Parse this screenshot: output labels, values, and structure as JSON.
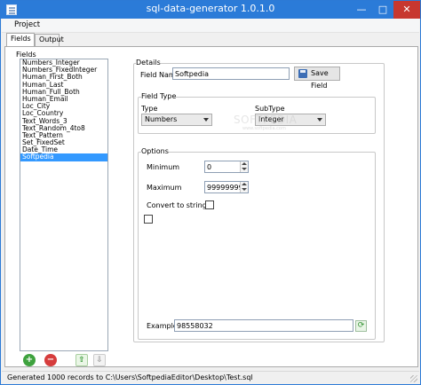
{
  "window": {
    "title": "sql-data-generator 1.0.1.0"
  },
  "titlebar_buttons": {
    "minimize": "—",
    "maximize": "□",
    "close": "✕"
  },
  "menu": {
    "items": [
      "Project"
    ]
  },
  "tabs": [
    {
      "label": "Fields",
      "active": true
    },
    {
      "label": "Output",
      "active": false
    }
  ],
  "fields_panel": {
    "label": "Fields",
    "items": [
      "Numbers_Integer",
      "Numbers_FixedInteger",
      "Human_First_Both",
      "Human_Last",
      "Human_Full_Both",
      "Human_Email",
      "Loc_City",
      "Loc_Country",
      "Text_Words_3",
      "Text_Random_4to8",
      "Text_Pattern",
      "Set_FixedSet",
      "Date_Time",
      "Softpedia"
    ],
    "selected_index": 13,
    "buttons": {
      "add": "+",
      "remove": "−",
      "move_up": "⇧",
      "move_down": "⇩"
    }
  },
  "details": {
    "label": "Details",
    "field_name_label": "Field Name",
    "field_name_value": "Softpedia",
    "save_button": "Save Field"
  },
  "field_type": {
    "label": "Field Type",
    "type_label": "Type",
    "type_value": "Numbers",
    "subtype_label": "SubType",
    "subtype_value": "Integer"
  },
  "options": {
    "label": "Options",
    "minimum_label": "Minimum",
    "minimum_value": "0",
    "maximum_label": "Maximum",
    "maximum_value": "99999999",
    "convert_label": "Convert to string",
    "convert_checked": false,
    "extra_checked": false,
    "example_label": "Example",
    "example_value": "98558032",
    "refresh_glyph": "⟳"
  },
  "watermark": {
    "main": "SOFTPEDIA",
    "sub": "www.softpedia.com"
  },
  "status": {
    "text": "Generated 1000 records to C:\\Users\\SoftpediaEditor\\Desktop\\Test.sql"
  },
  "colors": {
    "titlebar": "#2b7bd8",
    "selection": "#3399ff",
    "close_button": "#c7372f"
  }
}
